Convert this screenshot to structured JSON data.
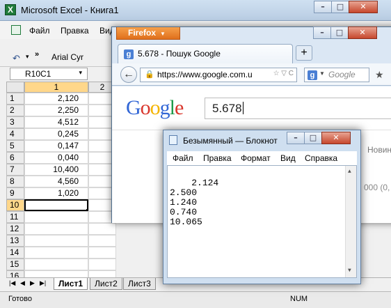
{
  "excel": {
    "title": "Microsoft Excel - Книга1",
    "logo_letter": "X",
    "menu": [
      "Файл",
      "Правка",
      "Вид"
    ],
    "toolbar": {
      "undo_icon": "↶",
      "arrow": "▾",
      "more": "»",
      "font": "Arial Cyr"
    },
    "namebox": "R10C1",
    "columns": [
      "1",
      "2"
    ],
    "rows": [
      "1",
      "2",
      "3",
      "4",
      "5",
      "6",
      "7",
      "8",
      "9",
      "10",
      "11",
      "12",
      "13",
      "14",
      "15",
      "16"
    ],
    "values": [
      "2,120",
      "2,250",
      "4,512",
      "0,245",
      "0,147",
      "0,040",
      "10,400",
      "4,560",
      "1,020"
    ],
    "sheets": [
      "Лист1",
      "Лист2",
      "Лист3"
    ],
    "nav": [
      "|◀",
      "◀",
      "▶",
      "▶|"
    ],
    "status": "Готово",
    "status_num": "NUM",
    "win_buttons": [
      "–",
      "□",
      "✕"
    ]
  },
  "firefox": {
    "app_button": "Firefox",
    "tab_title": "5.678 - Пошук Google",
    "new_tab": "+",
    "url": "https://www.google.com.u",
    "search_placeholder": "Google",
    "logo_letters": [
      "G",
      "o",
      "o",
      "g",
      "l",
      "e"
    ],
    "query": "5.678",
    "side_text_1": "Новин",
    "side_text_2": "000 (0,",
    "win_buttons": [
      "–",
      "□",
      "✕"
    ]
  },
  "notepad": {
    "title": "Безымянный — Блокнот",
    "menu": [
      "Файл",
      "Правка",
      "Формат",
      "Вид",
      "Справка"
    ],
    "content": "2.124\n2.500\n1.240\n0.740\n10.065",
    "win_buttons": [
      "–",
      "□",
      "✕"
    ]
  }
}
